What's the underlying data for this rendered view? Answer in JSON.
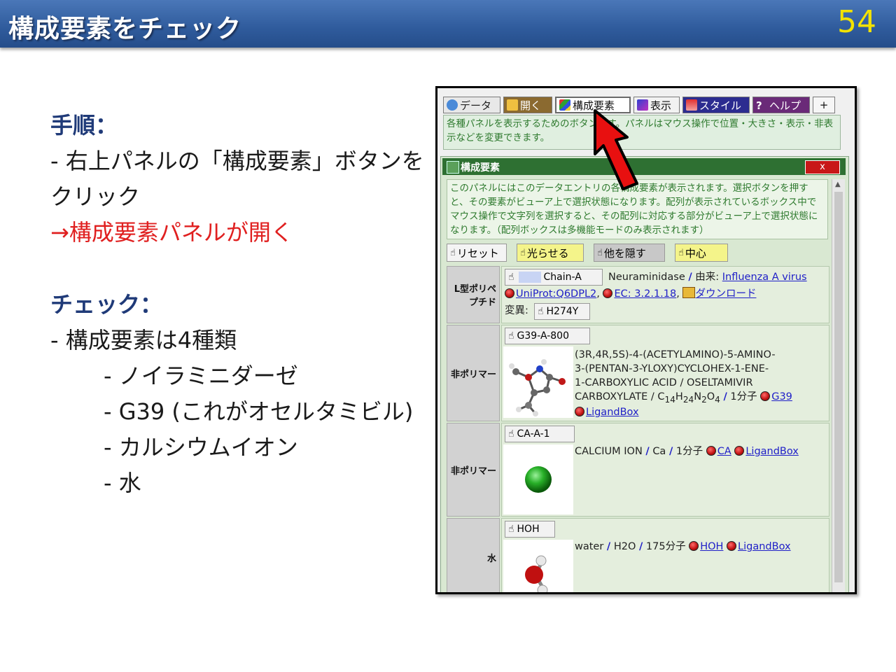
{
  "slide": {
    "title": "構成要素をチェック",
    "page_number": "54"
  },
  "left": {
    "procedure_heading": "手順：",
    "procedure_line1": "- 右上パネルの「構成要素」ボタンを",
    "procedure_line2": "クリック",
    "procedure_result": "→構成要素パネルが開く",
    "check_heading": "チェック：",
    "check_line1": "- 構成要素は4種類",
    "check_items": [
      "- ノイラミニダーゼ",
      "- G39 (これがオセルタミビル)",
      "- カルシウムイオン",
      "- 水"
    ]
  },
  "viewer": {
    "toolbar": {
      "data": "データ",
      "open": "開く",
      "components": "構成要素",
      "display": "表示",
      "style": "スタイル",
      "help": "ヘルプ",
      "plus": "+"
    },
    "toolbar_desc": "各種パネルを表示するためのボタンです。パネルはマウス操作で位置・大きさ・表示・非表示などを変更できます。",
    "panel": {
      "title": "構成要素",
      "close": "x",
      "description": "このパネルにはこのデータエントリの各構成要素が表示されます。選択ボタンを押すと、その要素がビューア上で選択状態になります。配列が表示されているボックス中でマウス操作で文字列を選択すると、その配列に対応する部分がビューア上で選択状態になります。（配列ボックスは多機能モードのみ表示されます）",
      "actions": {
        "reset": "リセット",
        "glow": "光らせる",
        "hide_others": "他を隠す",
        "center": "中心"
      },
      "entries": [
        {
          "label": "L型ポリペプチド",
          "chip": "Chain-A",
          "name": "Neuraminidase",
          "origin_label": "由来:",
          "origin": "Influenza A virus",
          "uniprot": "UniProt:Q6DPL2",
          "ec": "EC: 3.2.1.18",
          "download": "ダウンロード",
          "mutation_label": "変異:",
          "mutation": "H274Y"
        },
        {
          "label": "非ポリマー",
          "chip": "G39-A-800",
          "lines": [
            "(3R,4R,5S)-4-(ACETYLAMINO)-5-AMINO-",
            "3-(PENTAN-3-YLOXY)CYCLOHEX-1-ENE-",
            "1-CARBOXYLIC ACID / OSELTAMIVIR"
          ],
          "formula_prefix": "CARBOXYLATE / C",
          "formula": [
            "14",
            "H",
            "24",
            "N",
            "2",
            "O",
            "4"
          ],
          "count": "1分子",
          "link1": "G39",
          "link2": "LigandBox"
        },
        {
          "label": "非ポリマー",
          "chip": "CA-A-1",
          "name": "CALCIUM ION",
          "symbol": "Ca",
          "count": "1分子",
          "link1": "CA",
          "link2": "LigandBox"
        },
        {
          "label": "水",
          "chip": "HOH",
          "name": "water",
          "formula": "H2O",
          "count": "175分子",
          "link1": "HOH",
          "link2": "LigandBox"
        }
      ]
    }
  },
  "colors": {
    "header_blue": "#2f5b9c",
    "page_number_yellow": "#f2e200",
    "heading_navy": "#1f3a78",
    "result_red": "#e02020",
    "panel_green": "#2e7032",
    "link_blue": "#2020c8",
    "arrow_red": "#e81010"
  },
  "icons": [
    "data-icon",
    "open-icon",
    "components-icon",
    "display-icon",
    "style-icon",
    "help-icon",
    "hand-icon",
    "ball-icon",
    "download-icon",
    "red-arrow-icon"
  ]
}
